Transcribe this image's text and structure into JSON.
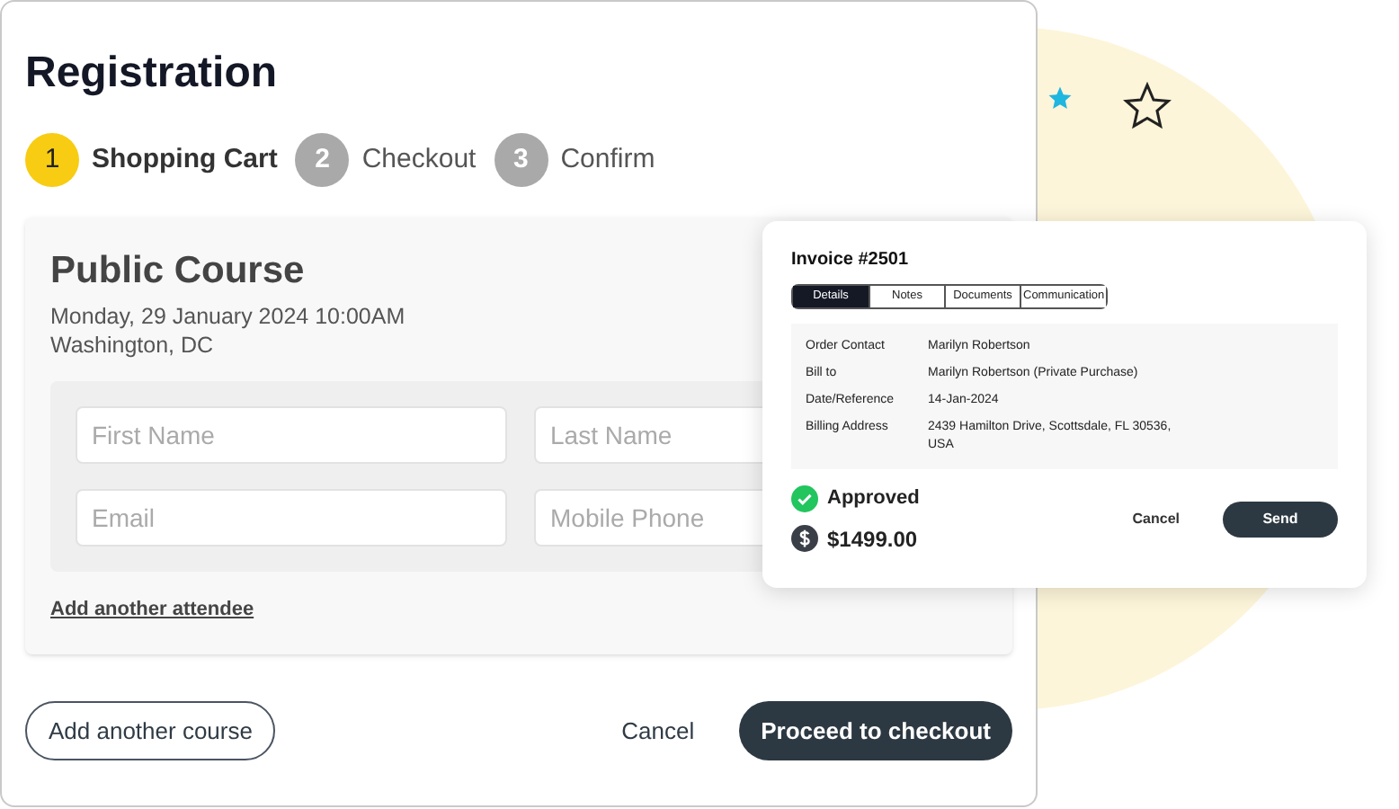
{
  "title": "Registration",
  "steps": [
    {
      "number": "1",
      "label": "Shopping Cart",
      "selected": true
    },
    {
      "number": "2",
      "label": "Checkout",
      "selected": false
    },
    {
      "number": "3",
      "label": "Confirm",
      "selected": false
    }
  ],
  "course": {
    "title": "Public Course",
    "date": "Monday, 29 January 2024 10:00AM",
    "location": "Washington, DC"
  },
  "attendee_fields": [
    {
      "placeholder": "First Name"
    },
    {
      "placeholder": "Last Name"
    },
    {
      "placeholder": "Email"
    },
    {
      "placeholder": "Mobile Phone"
    }
  ],
  "add_attendee_link": "Add another attendee",
  "add_course_button": "Add another course",
  "cancel_button": "Cancel",
  "proceed_button": "Proceed to checkout",
  "invoice": {
    "title": "Invoice #2501",
    "tabs": [
      {
        "label": "Details",
        "selected": true
      },
      {
        "label": "Notes",
        "selected": false
      },
      {
        "label": "Documents",
        "selected": false
      },
      {
        "label": "Communication",
        "selected": false
      }
    ],
    "details": [
      {
        "label": "Order Contact",
        "value": "Marilyn Robertson"
      },
      {
        "label": "Bill to",
        "value": "Marilyn Robertson (Private Purchase)"
      },
      {
        "label": "Date/Reference",
        "value": "14-Jan-2024"
      },
      {
        "label": "Billing Address",
        "value": "2439 Hamilton Drive, Scottsdale, FL 30536, USA"
      }
    ],
    "status": "Approved",
    "amount": "$1499.00",
    "cancel_button": "Cancel",
    "send_button": "Send"
  }
}
